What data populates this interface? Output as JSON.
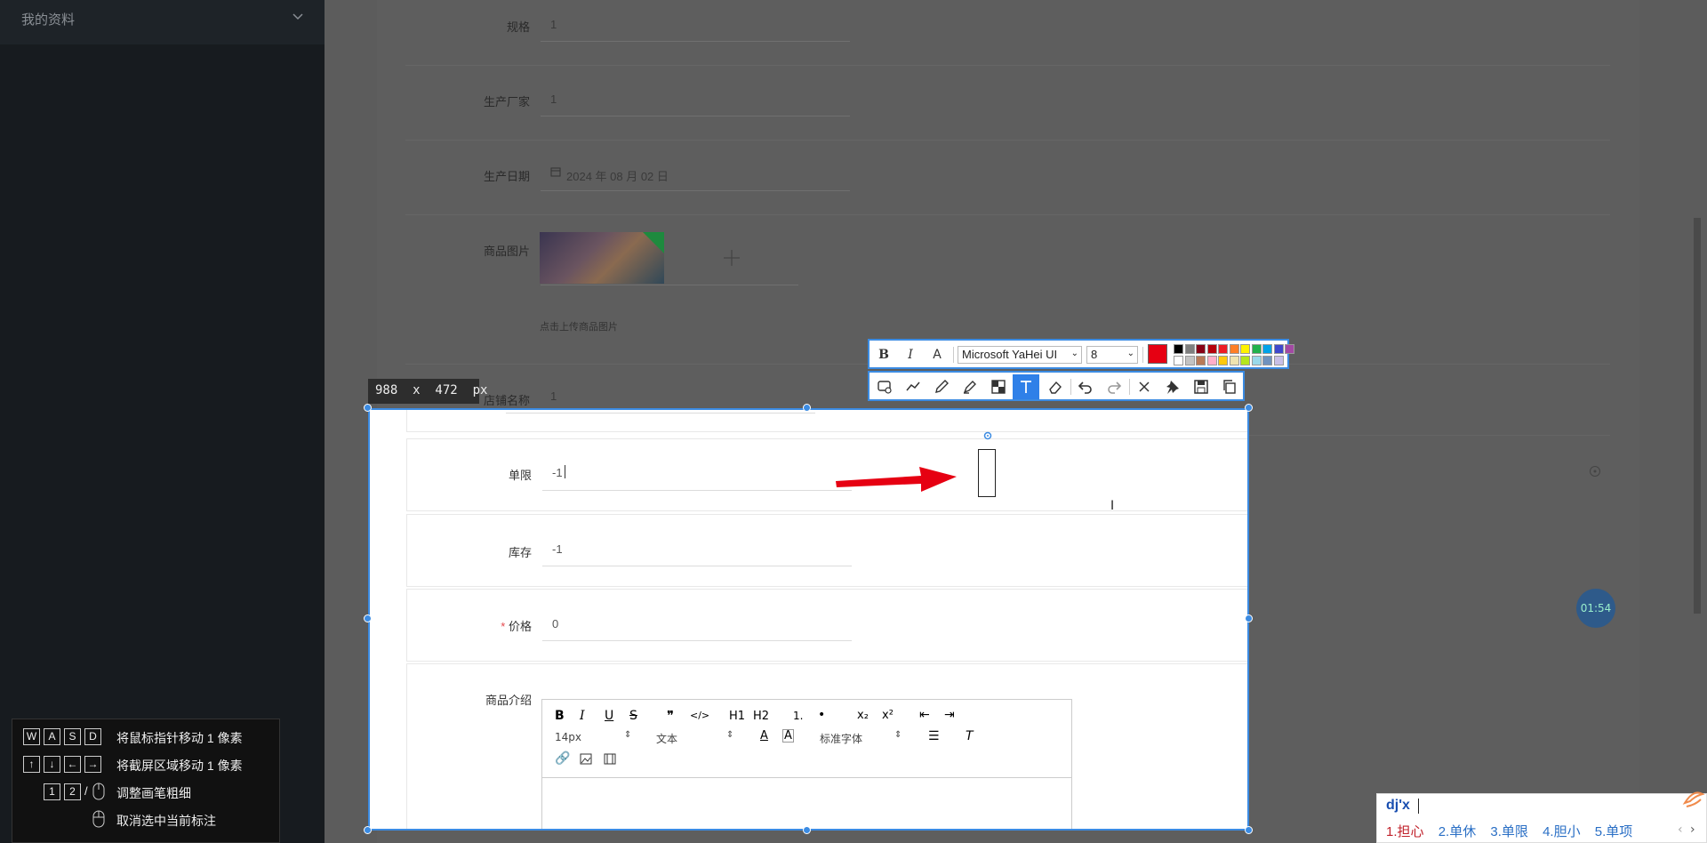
{
  "sidebar": {
    "title": "我的资料"
  },
  "form": {
    "rows_dim": [
      {
        "label": "规格",
        "value": "1"
      },
      {
        "label": "生产厂家",
        "value": "1"
      },
      {
        "label": "生产日期",
        "value": "2024 年 08 月 02 日"
      },
      {
        "label": "商品图片",
        "value": ""
      },
      {
        "label": "店铺名称",
        "value": "1"
      }
    ],
    "upload_hint": "点击上传商品图片",
    "image_caption": "",
    "rows_sel": [
      {
        "label": "单限",
        "value": "-1"
      },
      {
        "label": "库存",
        "value": "-1"
      },
      {
        "label": "价格",
        "value": "0",
        "required": "*"
      },
      {
        "label": "商品介绍",
        "value": ""
      }
    ]
  },
  "screenshot": {
    "size_label": "988  x  472  px",
    "text_toolbar": {
      "bold": "B",
      "italic": "I",
      "outline": "A",
      "font_name": "Microsoft YaHei UI",
      "font_size": "8",
      "active_color": "#e60012"
    },
    "palette": [
      "#000000",
      "#7f7f7f",
      "#880015",
      "#b5000b",
      "#ed1c24",
      "#ff7f27",
      "#fff200",
      "#22b14c",
      "#00a2e8",
      "#3f48cc",
      "#a349a4",
      "#ffffff",
      "#c3c3c3",
      "#b97a57",
      "#ffaec9",
      "#ffc90e",
      "#efe4b0",
      "#b5e61d",
      "#99d9ea",
      "#7092be",
      "#c8bfe7"
    ],
    "tools": [
      "shape-icon",
      "polyline-icon",
      "pen-icon",
      "marker-icon",
      "mosaic-icon",
      "text-icon",
      "eraser-icon",
      "undo-icon",
      "redo-icon",
      "close-icon",
      "pin-icon",
      "save-icon",
      "copy-icon"
    ]
  },
  "editor": {
    "toolbar_row1": [
      "B",
      "I",
      "U",
      "S",
      "❞",
      "</>",
      "H1",
      "H2",
      "1.",
      "•",
      "x₂",
      "x²",
      "⇤",
      "⇥"
    ],
    "font_size": "14px",
    "block_type": "文本",
    "font_family": "标准字体"
  },
  "shortcuts": [
    {
      "keys": [
        "W",
        "A",
        "S",
        "D"
      ],
      "text": "将鼠标指针移动 1 像素"
    },
    {
      "keys": [
        "↑",
        "↓",
        "←",
        "→"
      ],
      "text": "将截屏区域移动 1 像素"
    },
    {
      "keys": [
        "1",
        "2",
        "/"
      ],
      "text": "调整画笔粗细"
    },
    {
      "keys": [],
      "text": "取消选中当前标注"
    }
  ],
  "ime": {
    "input": "dj'x",
    "candidates": [
      "1.担心",
      "2.单休",
      "3.单限",
      "4.胆小",
      "5.单项"
    ]
  },
  "timer": "01:54"
}
